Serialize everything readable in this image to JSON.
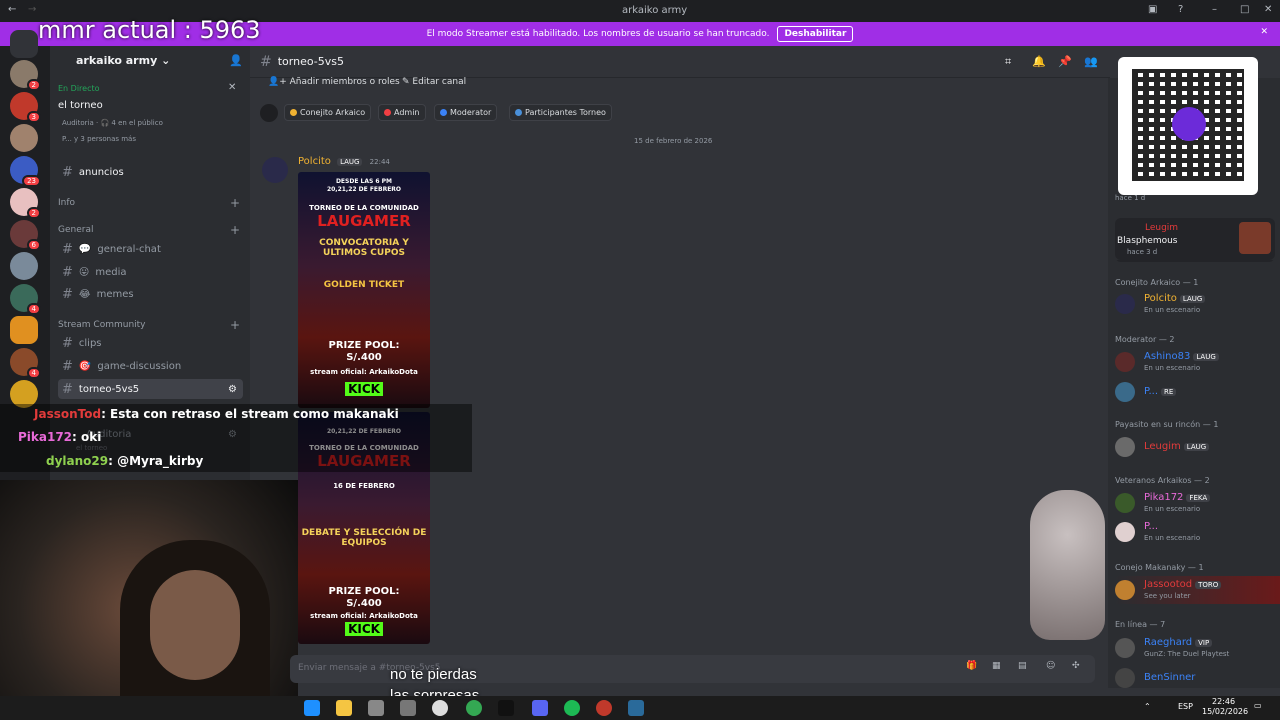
{
  "window": {
    "title": "arkaiko army"
  },
  "overlay_top": {
    "mmr": "mmr actual : 5963"
  },
  "streamer_banner": {
    "text": "El modo Streamer está habilitado. Los nombres de usuario se han truncado.",
    "button": "Deshabilitar"
  },
  "server": {
    "name": "arkaiko army"
  },
  "servers": [
    {
      "badge": "2"
    },
    {
      "badge": "3"
    },
    {
      "badge": ""
    },
    {
      "badge": "23"
    },
    {
      "badge": "2"
    },
    {
      "badge": "6"
    },
    {
      "badge": "4"
    },
    {
      "badge": "4"
    },
    {
      "badge": ""
    },
    {
      "badge": "4"
    },
    {
      "badge": ""
    }
  ],
  "live": {
    "label": "En Directo",
    "title": "el torneo",
    "aud": "Auditoria",
    "audience": "4 en el público",
    "more": "P... y 3 personas más"
  },
  "channels": {
    "anuncios": "anuncios",
    "info": "Info",
    "general_cat": "General",
    "general_chat": "general-chat",
    "media": "media",
    "memes": "memes",
    "stream_cat": "Stream Community",
    "clips": "clips",
    "game": "game-discussion",
    "torneo": "torneo-5vs5",
    "auditoria": "Auditoria",
    "sub": "el torneo"
  },
  "channel_header": {
    "name": "torneo-5vs5"
  },
  "actions": {
    "add": "Añadir miembros o roles",
    "edit": "Editar canal"
  },
  "tags": [
    {
      "label": "Conejito Arkaico",
      "color": "#f0b232"
    },
    {
      "label": "Admin",
      "color": "#f23f43"
    },
    {
      "label": "Moderator",
      "color": "#3b82f6"
    },
    {
      "label": "Participantes Torneo",
      "color": "#4a90d9"
    }
  ],
  "date_divider": "15 de febrero de 2026",
  "message": {
    "author": "Polcito",
    "tag": "LAUG",
    "time": "22:44"
  },
  "poster1": {
    "l1": "DESDE LAS 6 PM",
    "l2": "20,21,22 DE FEBRERO",
    "l3": "TORNEO DE LA COMUNIDAD",
    "l4": "LAUGAMER",
    "l5": "CONVOCATORIA Y ULTIMOS CUPOS",
    "l6": "GOLDEN TICKET",
    "l7": "PRIZE POOL:",
    "l8": "S/.400",
    "l9": "stream oficial: ArkaikoDota",
    "l10": "KICK"
  },
  "poster2": {
    "l2": "20,21,22 DE FEBRERO",
    "l3": "TORNEO DE LA COMUNIDAD",
    "l4": "LAUGAMER",
    "l5": "16 DE FEBRERO",
    "l6": "DEBATE Y SELECCIÓN DE EQUIPOS",
    "l7": "PRIZE POOL:",
    "l8": "S/.400",
    "l9": "stream oficial: ArkaikoDota",
    "l10": "KICK"
  },
  "chat_overlay": [
    {
      "user": "JassonTod",
      "msg": ": Esta con retraso el stream como makanaki",
      "color": "#e23b3b"
    },
    {
      "user": "Pika172",
      "msg": ": oki",
      "color": "#e86ad8"
    },
    {
      "user": "dylano29",
      "msg": ": @Myra_kirby",
      "color": "#8fd14f"
    }
  ],
  "composer": {
    "placeholder": "Enviar mensaje a #torneo-5vs5"
  },
  "caption": {
    "l1": "no te pierdas",
    "l2": "las sorpresas"
  },
  "activity": [
    {
      "time": "hace 1 d"
    },
    {
      "name": "Leugim",
      "title": "Blasphemous",
      "time": "hace 3 d"
    }
  ],
  "members": {
    "cat1": "Conejito Arkaico — 1",
    "m1": "Polcito",
    "m1tag": "LAUG",
    "m1st": "En un escenario",
    "cat2": "Moderator — 2",
    "m2": "Ashino83",
    "m2tag": "LAUG",
    "m2st": "En un escenario",
    "m3": "P...",
    "m3tag": "RE",
    "cat3": "Payasito en su rincón — 1",
    "m4": "Leugim",
    "m4tag": "LAUG",
    "cat4": "Veteranos Arkaikos — 2",
    "m5": "Pika172",
    "m5tag": "FEKA",
    "m5st": "En un escenario",
    "m6": "P...",
    "m6st": "En un escenario",
    "cat5": "Conejo Makanaky — 1",
    "m7": "Jassootod",
    "m7tag": "TORO",
    "m7st": "See you later",
    "cat6": "En línea — 7",
    "m8": "Raeghard",
    "m8tag": "VIP",
    "m8st": "GunZ: The Duel Playtest",
    "m9": "BenSinner"
  },
  "taskbar": {
    "lang": "ESP",
    "time": "22:46",
    "date": "15/02/2026"
  }
}
